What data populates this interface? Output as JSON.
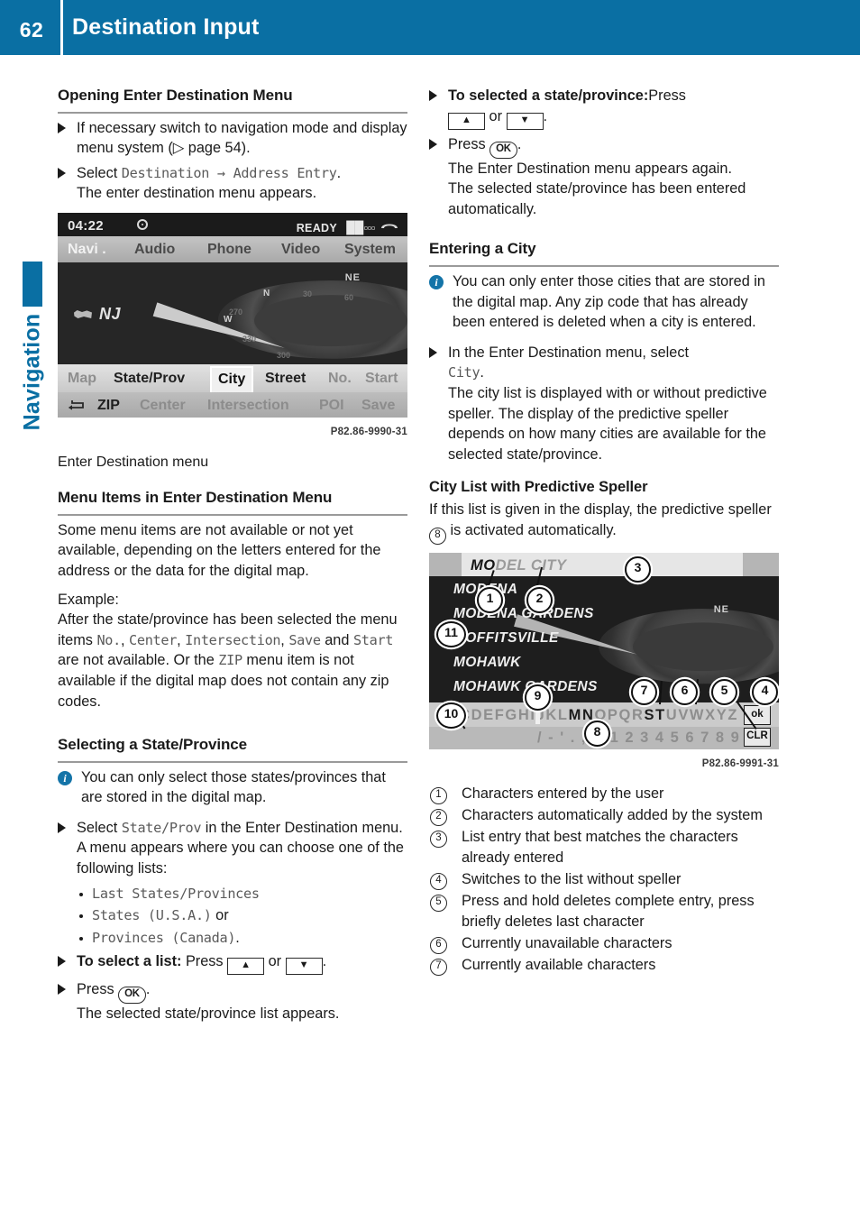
{
  "header": {
    "page_number": "62",
    "title": "Destination Input"
  },
  "side_tab": {
    "label": "Navigation"
  },
  "left_column": {
    "section1": {
      "heading": "Opening Enter Destination Menu",
      "step1": "If necessary switch to navigation mode and display menu system (▷ page 54).",
      "step2_prefix": "Select ",
      "step2_mono": "Destination → Address Entry",
      "step2_suffix": ".",
      "step2_result": "The enter destination menu appears."
    },
    "figure1": {
      "code": "P82.86-9990-31",
      "caption": "Enter Destination menu",
      "status": {
        "time": "04:22",
        "disc_icon": "disc-icon",
        "ready": "READY",
        "signal": "▉▉▫▫▫",
        "phone_icon": "phone-icon"
      },
      "tabs": [
        {
          "label": "Navi .",
          "active": true
        },
        {
          "label": "Audio",
          "active": false
        },
        {
          "label": "Phone",
          "active": false
        },
        {
          "label": "Video",
          "active": false
        },
        {
          "label": "System",
          "active": false
        }
      ],
      "map": {
        "state_abbrev": "NJ",
        "compass_label": "NE",
        "compass_w": "W",
        "compass_n": "N",
        "ticks": [
          "30",
          "60",
          "330",
          "300",
          "270"
        ]
      },
      "buttons_row1": [
        {
          "label": "Map",
          "state": "dim"
        },
        {
          "label": "State/Prov",
          "state": "on"
        },
        {
          "label": "City",
          "state": "selected"
        },
        {
          "label": "Street",
          "state": "on"
        },
        {
          "label": "No.",
          "state": "dim"
        },
        {
          "label": "Start",
          "state": "dim"
        }
      ],
      "buttons_row2": [
        {
          "label": "ZIP",
          "state": "on"
        },
        {
          "label": "Center",
          "state": "dim"
        },
        {
          "label": "Intersection",
          "state": "dim"
        },
        {
          "label": "POI",
          "state": "dim"
        },
        {
          "label": "Save",
          "state": "dim"
        }
      ],
      "back_icon": "back-arrow-icon"
    },
    "section2": {
      "heading": "Menu Items in Enter Destination Menu",
      "para1": "Some menu items are not available or not yet available, depending on the letters entered for the address or the data for the digital map.",
      "para2_label": "Example:",
      "para2_a": "After the state/province has been selected the menu items ",
      "m_no": "No.",
      "sep1": ", ",
      "m_center": "Center",
      "sep2": ", ",
      "m_intersection": "Intersection",
      "sep3": ", ",
      "m_save": "Save",
      "and_word": " and ",
      "m_start": "Start",
      "para2_b": " are not available. Or the ",
      "m_zip": "ZIP",
      "para2_c": " menu item is not available if the digital map does not contain any zip codes."
    },
    "section3": {
      "heading": "Selecting a State/Province",
      "info": "You can only select those states/provinces that are stored in the digital map.",
      "step1_prefix": "Select ",
      "step1_mono": "State/Prov",
      "step1_suffix": " in the Enter Destination menu.",
      "step1_result": "A menu appears where you can choose one of the following lists:",
      "list": [
        {
          "mono": "Last States/Provinces",
          "tail": ""
        },
        {
          "mono": "States (U.S.A.)",
          "tail": " or"
        },
        {
          "mono": "Provinces (Canada)",
          "tail": "."
        }
      ],
      "step2_bold": "To select a list:",
      "step2_press": " Press ",
      "key_up": "▲",
      "step2_or": " or ",
      "key_down": "▼",
      "step2_end": ".",
      "step3_press": "Press ",
      "key_ok": "OK",
      "step3_end": ".",
      "step3_result": "The selected state/province list appears."
    }
  },
  "right_column": {
    "step_select_state": {
      "bold": "To selected a state/province:",
      "press": "Press",
      "key_up": "▲",
      "or": " or ",
      "key_down": "▼",
      "end": "."
    },
    "step_press_ok": {
      "press": "Press ",
      "key_ok": "OK",
      "end": ".",
      "result_line1": "The Enter Destination menu appears again.",
      "result_line2": "The selected state/province has been entered automatically."
    },
    "section_entering_city": {
      "heading": "Entering a City",
      "info": "You can only enter those cities that are stored in the digital map. Any zip code that has already been entered is deleted when a city is entered.",
      "step_prefix": "In the Enter Destination menu, select ",
      "step_mono": "City",
      "step_suffix": ".",
      "step_result": "The city list is displayed with or without predictive speller. The display of the predictive speller depends on how many cities are available for the selected state/province."
    },
    "section_speller": {
      "heading": "City List with Predictive Speller",
      "para_a": "If this list is given in the display, the predictive speller ",
      "para_num": "8",
      "para_b": " is activated automatically."
    },
    "figure2": {
      "code": "P82.86-9991-31",
      "entry_typed": "MO",
      "entry_auto": "DEL CITY",
      "city_list": [
        "MODENA",
        "MODENA GARDENS",
        "MOFFITSVILLE",
        "MOHAWK",
        "MOHAWK GARDENS"
      ],
      "keyboard_row1": "ABCDEFGHIJKLMNOPQRSTUVWXYZ",
      "keyboard_row1_available": "MNST",
      "keyboard_row2": "/ - ' . , & 1 2 3 4 5 6 7 8 9 0",
      "key_ok": "ok",
      "key_clr": "CLR",
      "back_icon": "back-arrow-icon",
      "callouts": [
        "1",
        "2",
        "3",
        "4",
        "5",
        "6",
        "7",
        "8",
        "9",
        "10",
        "11"
      ],
      "compass_label": "NE"
    },
    "legend": [
      {
        "num": "1",
        "text": "Characters entered by the user"
      },
      {
        "num": "2",
        "text": "Characters automatically added by the system"
      },
      {
        "num": "3",
        "text": "List entry that best matches the characters already entered"
      },
      {
        "num": "4",
        "text": "Switches to the list without speller"
      },
      {
        "num": "5",
        "text": "Press and hold deletes complete entry, press briefly deletes last character"
      },
      {
        "num": "6",
        "text": "Currently unavailable characters"
      },
      {
        "num": "7",
        "text": "Currently available characters"
      }
    ]
  },
  "colors": {
    "brand_blue": "#0a6fa3",
    "info_blue": "#1474a8",
    "rule_gray": "#9a9a9a",
    "mono_gray": "#5a5a5a"
  }
}
